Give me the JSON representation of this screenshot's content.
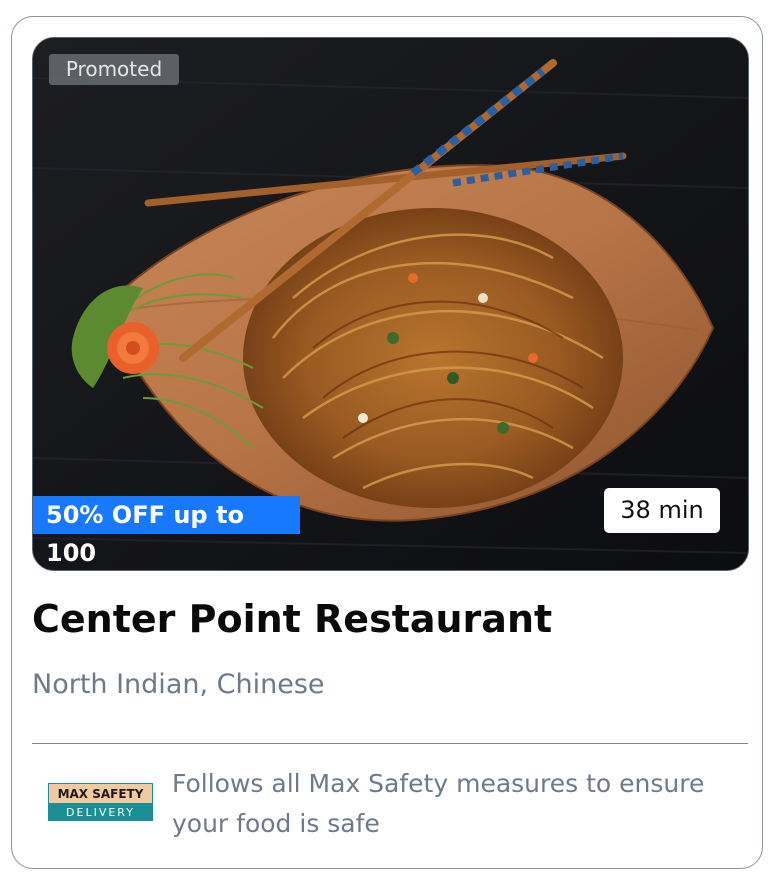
{
  "card": {
    "promoted_label": "Promoted",
    "offer_label": "50% OFF up to 100",
    "delivery_time": "38 min",
    "restaurant_name": "Center Point Restaurant",
    "cuisines": "North Indian, Chinese",
    "safety_badge": {
      "line1": "MAX SAFETY",
      "line2": "DELIVERY"
    },
    "safety_text": "Follows all Max Safety measures to ensure your food is safe"
  },
  "colors": {
    "offer_bg": "#1779ff",
    "muted_text": "#6e7a89",
    "badge_top": "#f3c9a0",
    "badge_bottom": "#1a8f95"
  },
  "image_subject": "noodles-with-chopsticks-on-wooden-leaf-plate"
}
